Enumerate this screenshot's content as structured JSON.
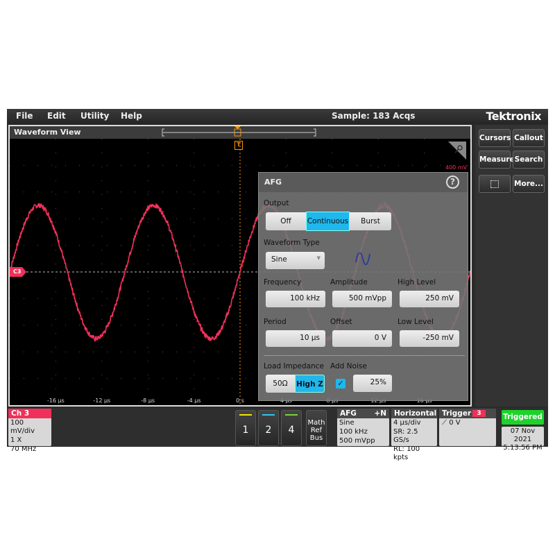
{
  "menu": {
    "items": [
      "File",
      "Edit",
      "Utility",
      "Help"
    ],
    "status": "Sample: 183 Acqs",
    "logo": "Tektronix"
  },
  "waveform_view": {
    "title": "Waveform View",
    "scale_label": "400 mV",
    "channel_marker": "C3",
    "trigger_marker": "T",
    "x_ticks": [
      "-16 µs",
      "-12 µs",
      "-8 µs",
      "-4 µs",
      "0 s",
      "4 µs",
      "8 µs",
      "12 µs",
      "16 µs"
    ],
    "trace_color": "#f0305a",
    "chart_data": {
      "type": "line",
      "x_unit": "µs",
      "xlim": [
        -20,
        20
      ],
      "ylim": [
        -500,
        500
      ],
      "y_unit": "mV",
      "waveform": "sine",
      "frequency_khz": 100,
      "amplitude_mvpp": 500,
      "offset_mv": 0,
      "noise_percent": 25
    }
  },
  "side_buttons": [
    "Cursors",
    "Callout",
    "Measure",
    "Search",
    "zoom-select",
    "More..."
  ],
  "afg": {
    "title": "AFG",
    "help": "?",
    "output_label": "Output",
    "output_options": [
      "Off",
      "Continuous",
      "Burst"
    ],
    "output_selected": "Continuous",
    "waveform_type_label": "Waveform Type",
    "waveform_type": "Sine",
    "frequency_label": "Frequency",
    "frequency": "100 kHz",
    "amplitude_label": "Amplitude",
    "amplitude": "500 mVpp",
    "high_level_label": "High Level",
    "high_level": "250 mV",
    "period_label": "Period",
    "period": "10 µs",
    "offset_label": "Offset",
    "offset": "0 V",
    "low_level_label": "Low Level",
    "low_level": "-250 mV",
    "load_label": "Load Impedance",
    "load_options": [
      "50Ω",
      "High Z"
    ],
    "load_selected": "High Z",
    "noise_label": "Add Noise",
    "noise_checked": true,
    "noise": "25%"
  },
  "bottom": {
    "ch3": {
      "title": "Ch 3",
      "lines": [
        "100 mV/div",
        "1 X",
        "70 MHz"
      ]
    },
    "channels": [
      {
        "label": "1",
        "color": "#f2e600"
      },
      {
        "label": "2",
        "color": "#2ec8f0"
      },
      {
        "label": "4",
        "color": "#7ad23a"
      }
    ],
    "math": [
      "Math",
      "Ref",
      "Bus"
    ],
    "afg": {
      "title": "AFG",
      "extra": "+N",
      "lines": [
        "Sine",
        "100 kHz",
        "500 mVpp"
      ]
    },
    "horizontal": {
      "title": "Horizontal",
      "lines": [
        "4 µs/div",
        "SR: 2.5 GS/s",
        "RL: 100 kpts"
      ]
    },
    "trigger": {
      "title": "Trigger",
      "source": "3",
      "level": "0 V"
    },
    "triggered": "Triggered",
    "date": "07 Nov 2021",
    "time": "5:13:56 PM"
  }
}
